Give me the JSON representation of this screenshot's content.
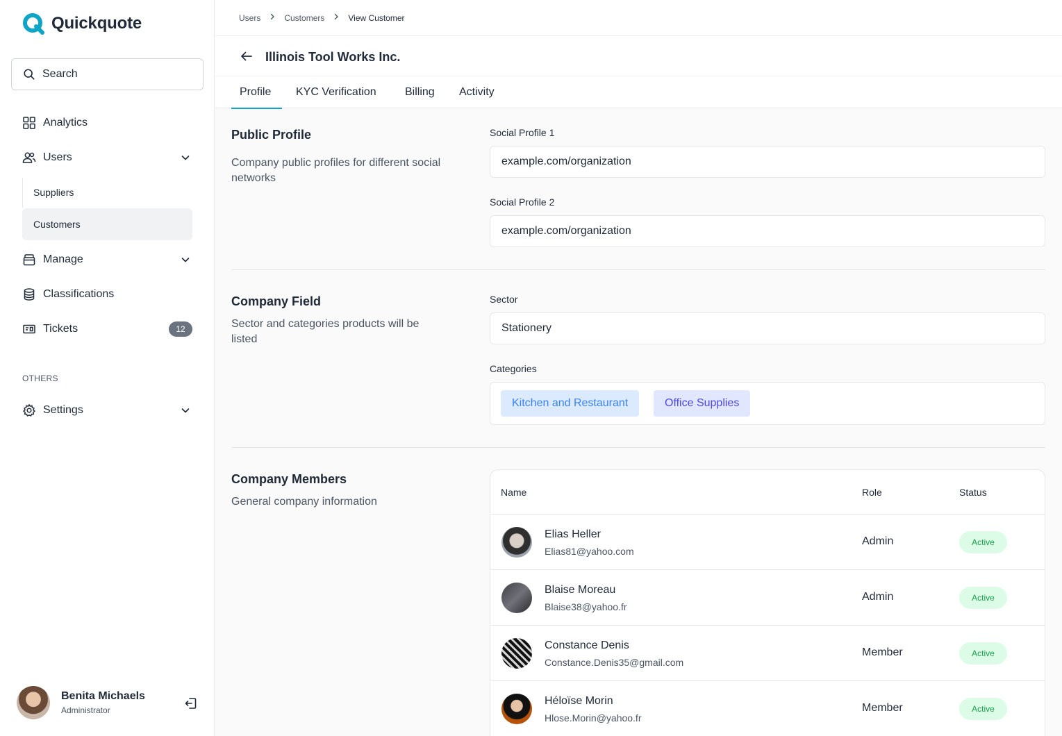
{
  "app": {
    "name": "Quickquote",
    "brand_color": "#0ea5c6"
  },
  "sidebar": {
    "search_label": "Search",
    "items": [
      {
        "label": "Analytics",
        "icon": "grid-icon"
      },
      {
        "label": "Users",
        "icon": "users-icon",
        "expanded": true
      },
      {
        "label": "Manage",
        "icon": "box-icon"
      },
      {
        "label": "Classifications",
        "icon": "database-icon"
      },
      {
        "label": "Tickets",
        "icon": "ticket-icon",
        "badge": "12"
      }
    ],
    "sub_items": [
      {
        "label": "Suppliers"
      },
      {
        "label": "Customers",
        "active": true
      }
    ],
    "others_title": "OTHERS",
    "settings_label": "Settings",
    "user": {
      "name": "Benita Michaels",
      "role": "Administrator"
    }
  },
  "breadcrumb": [
    "Users",
    "Customers",
    "View Customer"
  ],
  "page": {
    "title": "Illinois Tool Works Inc."
  },
  "tabs": [
    "Profile",
    "KYC Verification",
    "Billing",
    "Activity"
  ],
  "public_profile": {
    "title": "Public Profile",
    "description": "Company public profiles for different social networks",
    "social1_label": "Social Profile 1",
    "social1_value": "example.com/organization",
    "social2_label": "Social Profile 2",
    "social2_value": "example.com/organization"
  },
  "company_field": {
    "title": "Company Field",
    "description": "Sector and categories products will be listed",
    "sector_label": "Sector",
    "sector_value": "Stationery",
    "categories_label": "Categories",
    "categories": [
      "Kitchen and Restaurant",
      "Office Supplies"
    ]
  },
  "members": {
    "title": "Company Members",
    "description": "General company information",
    "columns": [
      "Name",
      "Role",
      "Status"
    ],
    "rows": [
      {
        "name": "Elias Heller",
        "email": "Elias81@yahoo.com",
        "role": "Admin",
        "status": "Active"
      },
      {
        "name": "Blaise Moreau",
        "email": "Blaise38@yahoo.fr",
        "role": "Admin",
        "status": "Active"
      },
      {
        "name": "Constance Denis",
        "email": "Constance.Denis35@gmail.com",
        "role": "Member",
        "status": "Active"
      },
      {
        "name": "Héloïse Morin",
        "email": "Hlose.Morin@yahoo.fr",
        "role": "Member",
        "status": "Active"
      }
    ]
  }
}
